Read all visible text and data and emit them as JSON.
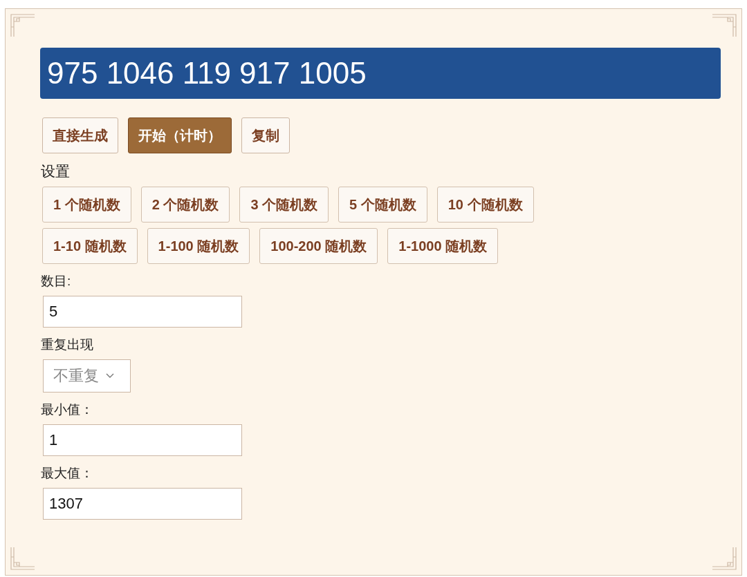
{
  "result": "975 1046 119 917 1005",
  "actions": [
    {
      "label": "直接生成",
      "selected": false
    },
    {
      "label": "开始（计时）",
      "selected": true
    },
    {
      "label": "复制",
      "selected": false
    }
  ],
  "settings_title": "设置",
  "preset_rows": [
    [
      "1 个随机数",
      "2 个随机数",
      "3 个随机数",
      "5 个随机数",
      "10 个随机数"
    ],
    [
      "1-10 随机数",
      "1-100 随机数",
      "100-200 随机数",
      "1-1000 随机数"
    ]
  ],
  "fields": [
    {
      "kind": "input",
      "label": "数目:",
      "value": "5"
    },
    {
      "kind": "select",
      "label": "重复出现",
      "value": "不重复",
      "disabled": true
    },
    {
      "kind": "input",
      "label": "最小值：",
      "value": "1"
    },
    {
      "kind": "input",
      "label": "最大值：",
      "value": "1307"
    }
  ]
}
